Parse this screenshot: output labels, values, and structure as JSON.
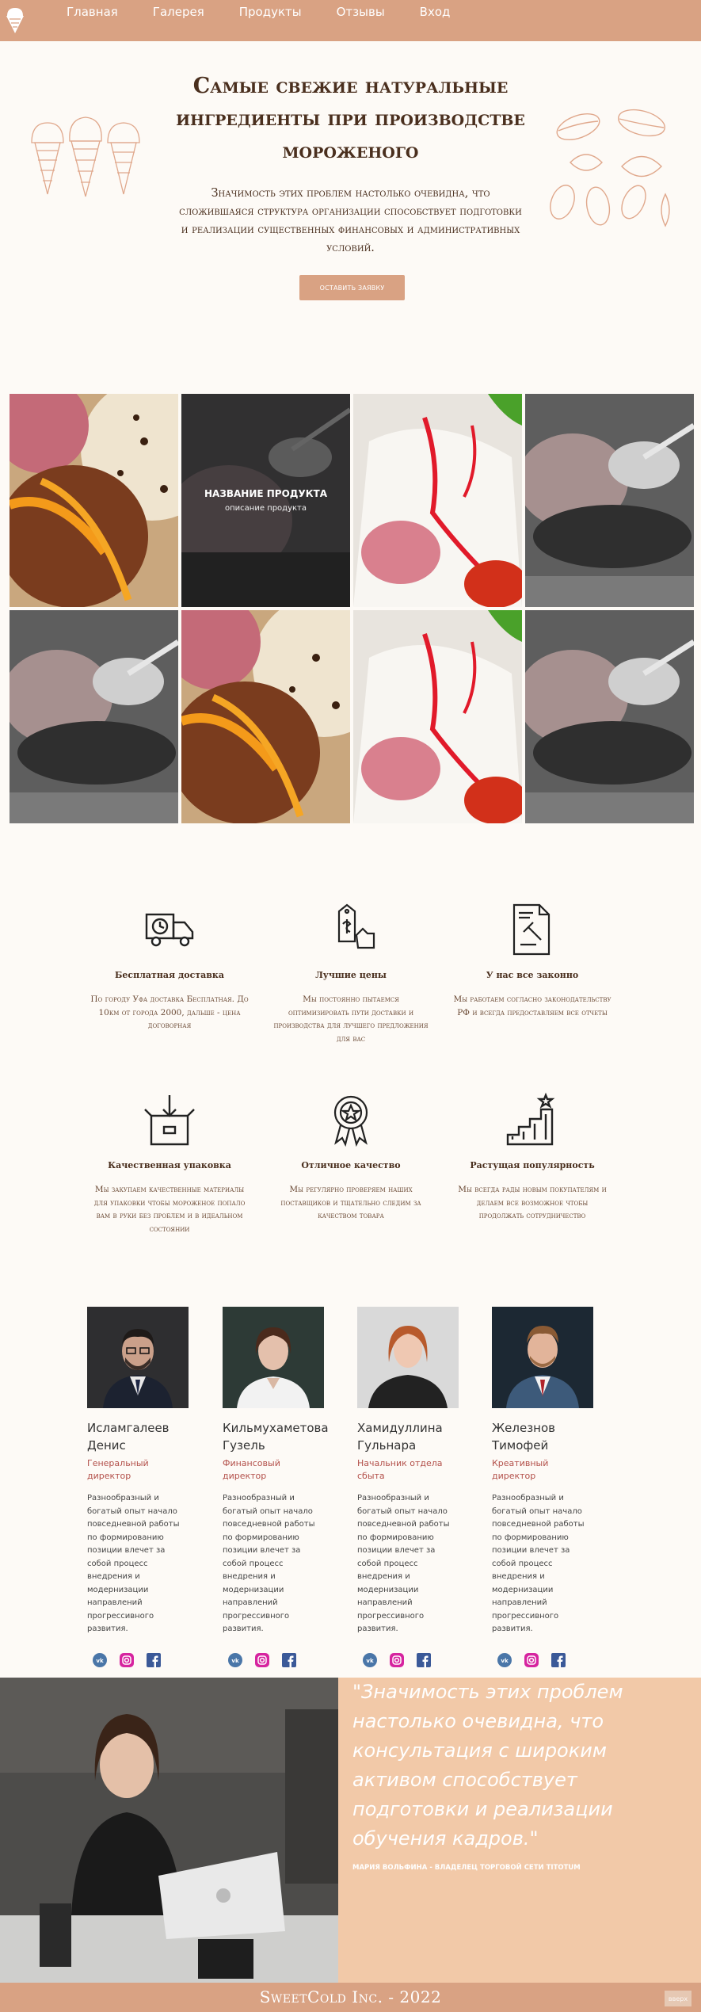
{
  "nav": {
    "items": [
      "Главная",
      "Галерея",
      "Продукты",
      "Отзывы",
      "Вход"
    ]
  },
  "hero": {
    "title": "Самые свежие натуральные ингредиенты при производстве мороженого",
    "text": "Значимость этих проблем настолько очевидна, что сложившаяся структура организации способствует подготовки и реализации существенных финансовых и административных условий.",
    "button": "ОСТАВИТЬ ЗАЯВКУ"
  },
  "gallery": {
    "overlay_title": "НАЗВАНИЕ ПРОДУКТА",
    "overlay_desc": "описание продукта"
  },
  "features": [
    {
      "icon": "delivery-truck-icon",
      "title": "Бесплатная доставка",
      "text": "По городу Уфа доставка Бесплатная. До 10км от города 2000, дальше - цена договорная"
    },
    {
      "icon": "price-tag-icon",
      "title": "Лучшие цены",
      "text": "Мы постоянно пытаемся оптимизировать пути доставки и производства для лучшего предложения для вас"
    },
    {
      "icon": "law-document-icon",
      "title": "У нас все законно",
      "text": "Мы работаем согласно законодательству РФ и всегда предоставляем все отчеты"
    },
    {
      "icon": "package-box-icon",
      "title": "Качественная упаковка",
      "text": "Мы закупаем качественные материалы для упаковки чтобы мороженое попало вам в руки без проблем и в идеальном состоянии"
    },
    {
      "icon": "quality-badge-icon",
      "title": "Отличное качество",
      "text": "Мы регулярно проверяем наших поставщиков и тщательно следим за качеством товара"
    },
    {
      "icon": "growth-stairs-icon",
      "title": "Растущая популярность",
      "text": "Мы всегда рады новым покупателям и делаем все возможное чтобы продолжать сотрудничество"
    }
  ],
  "team": [
    {
      "name": "Исламгалеев Денис",
      "role": "Генеральный директор",
      "desc": "Разнообразный и богатый опыт начало повседневной работы по формированию позиции влечет за собой процесс внедрения и модернизации направлений прогрессивного развития."
    },
    {
      "name": "Кильмухаметова Гузель",
      "role": "Финансовый директор",
      "desc": "Разнообразный и богатый опыт начало повседневной работы по формированию позиции влечет за собой процесс внедрения и модернизации направлений прогрессивного развития."
    },
    {
      "name": "Хамидуллина Гульнара",
      "role": "Начальник отдела сбыта",
      "desc": "Разнообразный и богатый опыт начало повседневной работы по формированию позиции влечет за собой процесс внедрения и модернизации направлений прогрессивного развития."
    },
    {
      "name": "Железнов Тимофей",
      "role": "Креативный директор",
      "desc": "Разнообразный и богатый опыт начало повседневной работы по формированию позиции влечет за собой процесс внедрения и модернизации направлений прогрессивного развития."
    }
  ],
  "quote": {
    "text": "\"Значимость этих проблем настолько очевидна, что консультация с широким активом способствует подготовки и реализации обучения кадров.\"",
    "author": "МАРИЯ ВОЛЬФИНА - ВЛАДЕЛЕЦ ТОРГОВОЙ СЕТИ TITOTUM"
  },
  "footer": {
    "text": "SweetCold Inc. - 2022",
    "up_button": "вверх"
  },
  "colors": {
    "accent": "#d9a283",
    "quote_bg": "#f2c9a8",
    "text_brown": "#4a2f1e",
    "role_red": "#b3504a"
  }
}
